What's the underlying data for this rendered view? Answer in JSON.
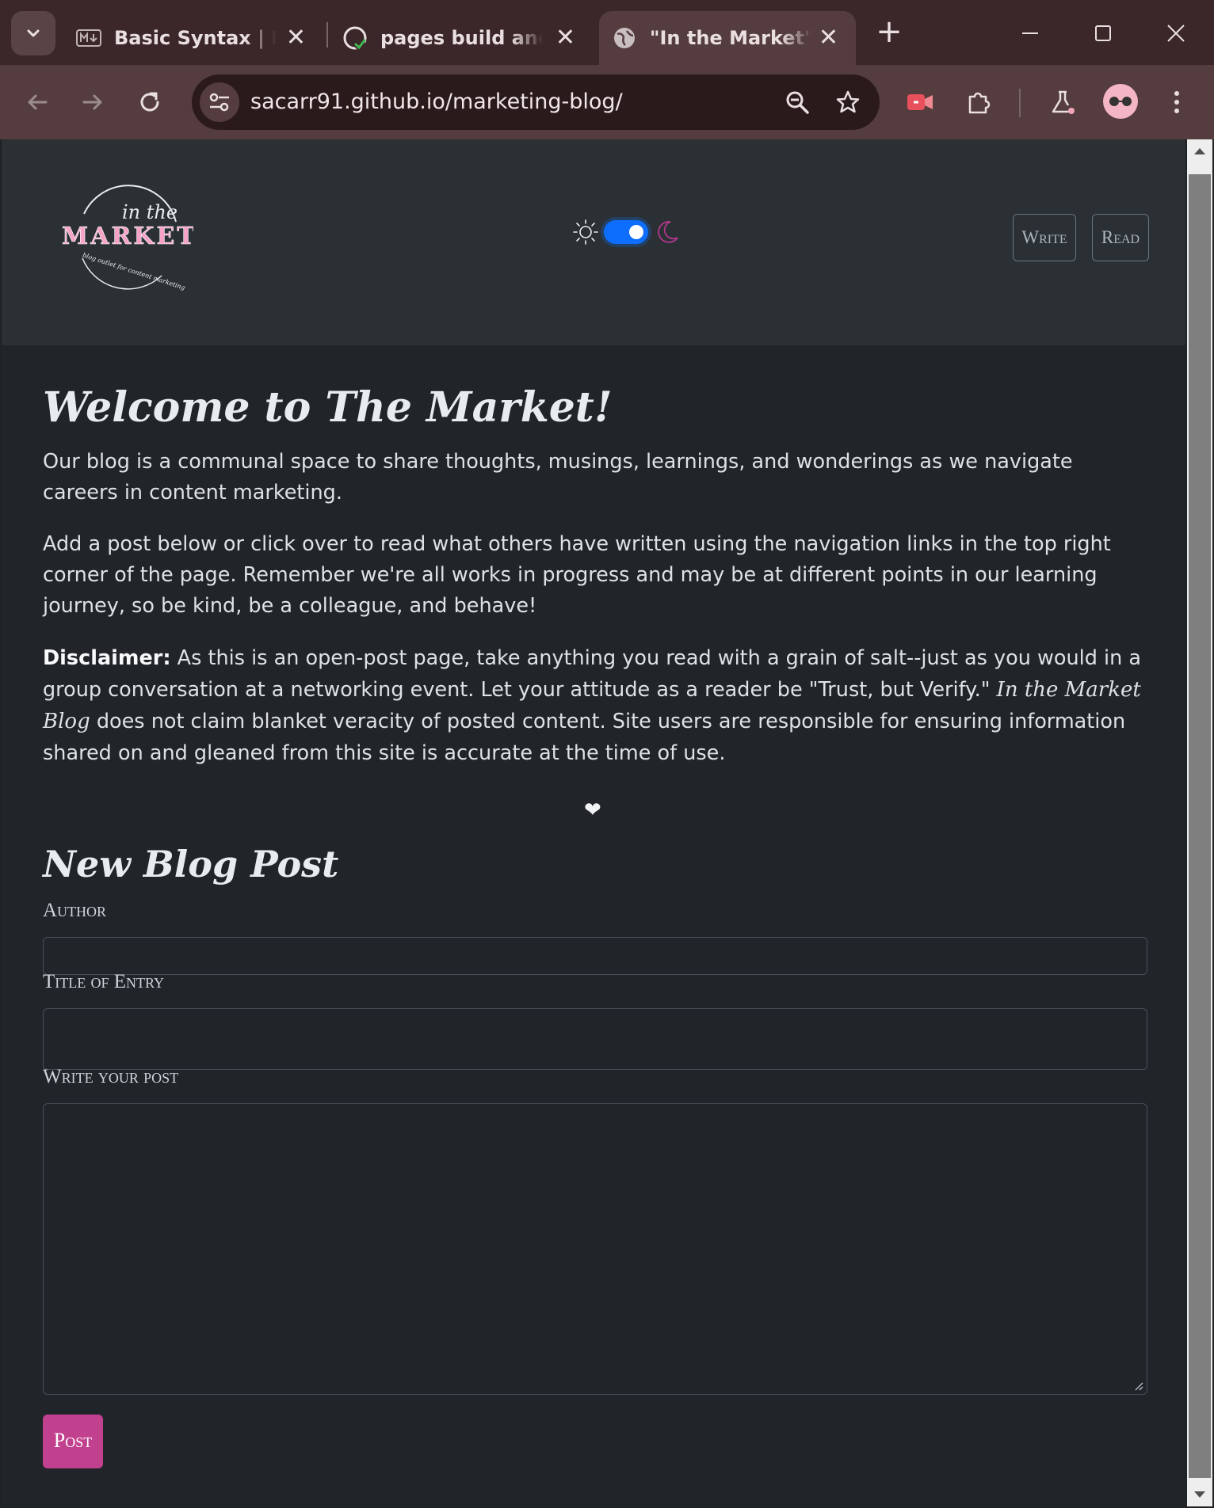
{
  "browser": {
    "tabs": [
      {
        "title": "Basic Syntax | Markdown Guide",
        "favicon": "markdown-icon"
      },
      {
        "title": "pages build and deployment",
        "favicon": "github-icon"
      },
      {
        "title": "\"In the Market\" Homepage",
        "favicon": "globe-icon",
        "active": true
      }
    ],
    "url": "sacarr91.github.io/marketing-blog/"
  },
  "header": {
    "logo": {
      "top_text": "in the",
      "main_text": "MARKET",
      "bottom_text": "blog outlet for content marketing"
    },
    "theme": {
      "mode": "dark",
      "enabled": true
    },
    "nav": [
      {
        "label": "Write"
      },
      {
        "label": "Read"
      }
    ]
  },
  "main": {
    "welcome_title": "Welcome to The Market!",
    "intro": "Our blog is a communal space to share thoughts, musings, learnings, and wonderings as we navigate careers in content marketing.",
    "instructions": "Add a post below or click over to read what others have written using the navigation links in the top right corner of the page. Remember we're all works in progress and may be at different points in our learning journey, so be kind, be a colleague, and behave!",
    "disclaimer": {
      "label": "Disclaimer:",
      "text_before": " As this is an open-post page, take anything you read with a grain of salt--just as you would in a group conversation at a networking event. Let your attitude as a reader be \"Trust, but Verify.\" ",
      "brand": "In the Market Blog",
      "text_after": " does not claim blanket veracity of posted content. Site users are responsible for ensuring information shared on and gleaned from this site is accurate at the time of use."
    },
    "heart": "❤"
  },
  "form": {
    "title": "New Blog Post",
    "author_label": "Author",
    "author_value": "",
    "title_label": "Title of Entry",
    "title_value": "",
    "post_label": "Write your post",
    "post_value": "",
    "submit_label": "Post"
  },
  "colors": {
    "accent": "#c2418f",
    "toggle": "#0d6efd",
    "logo_pink": "#f5a3c7"
  }
}
